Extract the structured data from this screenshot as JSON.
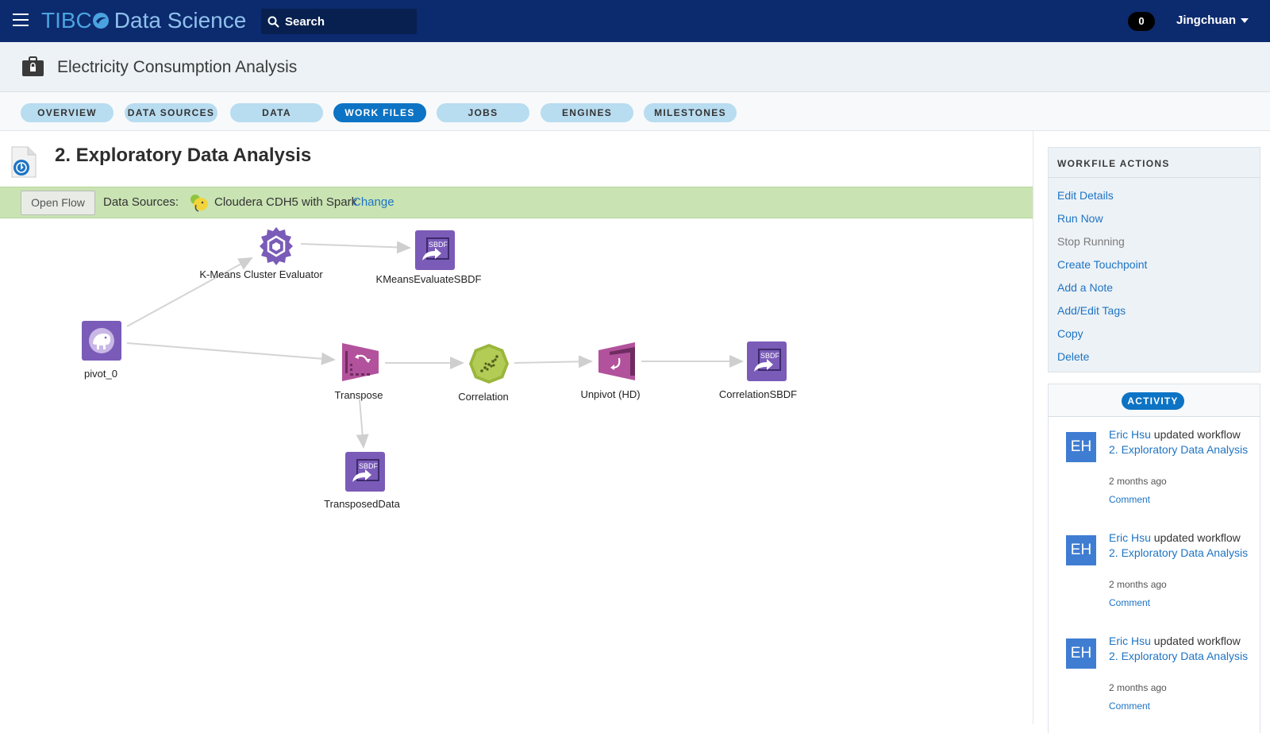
{
  "topbar": {
    "brand_left": "TIBC",
    "brand_right": "Data Science",
    "search_label": "Search",
    "notification_count": "0",
    "user_name": "Jingchuan"
  },
  "workspace": {
    "title": "Electricity Consumption Analysis"
  },
  "tabs": [
    {
      "label": "OVERVIEW",
      "active": false
    },
    {
      "label": "DATA SOURCES",
      "active": false
    },
    {
      "label": "DATA",
      "active": false
    },
    {
      "label": "WORK FILES",
      "active": true
    },
    {
      "label": "JOBS",
      "active": false
    },
    {
      "label": "ENGINES",
      "active": false
    },
    {
      "label": "MILESTONES",
      "active": false
    }
  ],
  "workfile": {
    "title": "2. Exploratory Data Analysis",
    "open_flow_label": "Open Flow",
    "data_sources_label": "Data Sources:",
    "data_source_name": "Cloudera CDH5 with Spark",
    "change_label": "Change"
  },
  "flow": {
    "nodes": [
      {
        "id": "pivot",
        "label": "pivot_0",
        "icon": "hadoop-elephant-icon"
      },
      {
        "id": "kmeans",
        "label": "K-Means Cluster Evaluator",
        "icon": "kmeans-evaluator-icon"
      },
      {
        "id": "kmeans_sbdf",
        "label": "KMeansEvaluateSBDF",
        "icon": "sbdf-export-icon",
        "badge": "SBDF"
      },
      {
        "id": "transpose",
        "label": "Transpose",
        "icon": "transpose-icon"
      },
      {
        "id": "correlation",
        "label": "Correlation",
        "icon": "correlation-icon"
      },
      {
        "id": "unpivot",
        "label": "Unpivot (HD)",
        "icon": "unpivot-icon"
      },
      {
        "id": "corr_sbdf",
        "label": "CorrelationSBDF",
        "icon": "sbdf-export-icon",
        "badge": "SBDF"
      },
      {
        "id": "transposed_data",
        "label": "TransposedData",
        "icon": "sbdf-export-icon",
        "badge": "SBDF"
      }
    ]
  },
  "sidebar": {
    "actions_title": "WORKFILE ACTIONS",
    "actions": [
      {
        "label": "Edit Details",
        "enabled": true
      },
      {
        "label": "Run Now",
        "enabled": true
      },
      {
        "label": "Stop Running",
        "enabled": false
      },
      {
        "label": "Create Touchpoint",
        "enabled": true
      },
      {
        "label": "Add a Note",
        "enabled": true
      },
      {
        "label": "Add/Edit Tags",
        "enabled": true
      },
      {
        "label": "Copy",
        "enabled": true
      },
      {
        "label": "Delete",
        "enabled": true
      }
    ],
    "activity_title": "ACTIVITY",
    "activity": [
      {
        "initials": "EH",
        "user": "Eric Hsu",
        "action": "updated workflow",
        "target": "2. Exploratory Data Analysis",
        "time": "2 months ago",
        "comment": "Comment"
      },
      {
        "initials": "EH",
        "user": "Eric Hsu",
        "action": "updated workflow",
        "target": "2. Exploratory Data Analysis",
        "time": "2 months ago",
        "comment": "Comment"
      },
      {
        "initials": "EH",
        "user": "Eric Hsu",
        "action": "updated workflow",
        "target": "2. Exploratory Data Analysis",
        "time": "2 months ago",
        "comment": "Comment"
      }
    ]
  },
  "colors": {
    "topbar": "#0c2a6e",
    "accent": "#0d73c4",
    "tab_inactive": "#b8dcf0",
    "datasource_bar": "#c9e3b3",
    "node_purple": "#7a5bb8",
    "node_pink": "#b2529c",
    "node_green": "#9ab63c"
  }
}
